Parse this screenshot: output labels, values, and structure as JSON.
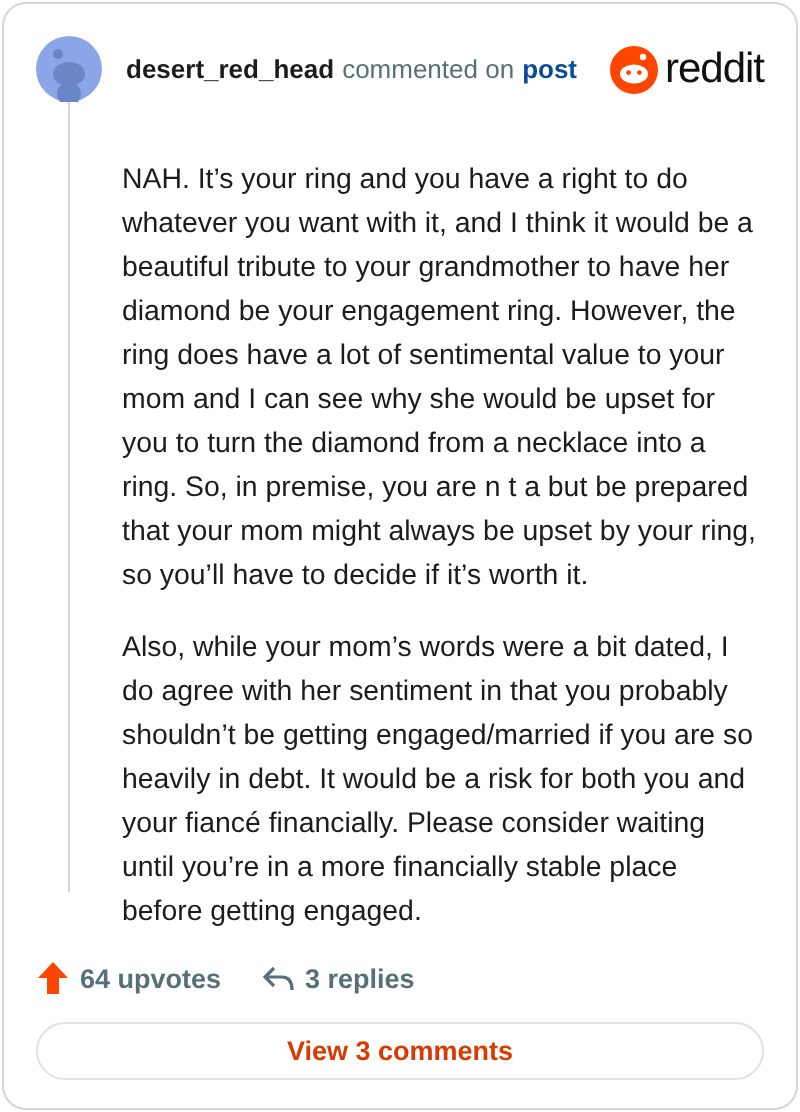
{
  "header": {
    "username": "desert_red_head",
    "action": "commented on",
    "link": "post",
    "brand": "reddit"
  },
  "paragraphs": [
    "NAH. It’s your ring and you have a right to do whatever you want with it, and I think it would be a beautiful tribute to your grandmother to have her diamond be your engagement ring. However, the ring does have a lot of sentimental value to your mom and I can see why she would be upset for you to turn the diamond from a necklace into a ring. So, in premise, you are n t a but be prepared that your mom might always be upset by your ring, so you’ll have to decide if it’s worth it.",
    "Also, while your mom’s words were a bit dated, I do agree with her sentiment in that you probably shouldn’t be getting engaged/married if you are so heavily in debt. It would be a risk for both you and your fiancé financially. Please consider waiting until you’re in a more financially stable place before getting engaged."
  ],
  "footer": {
    "upvotes": "64 upvotes",
    "replies": "3 replies"
  },
  "button": "View 3 comments"
}
